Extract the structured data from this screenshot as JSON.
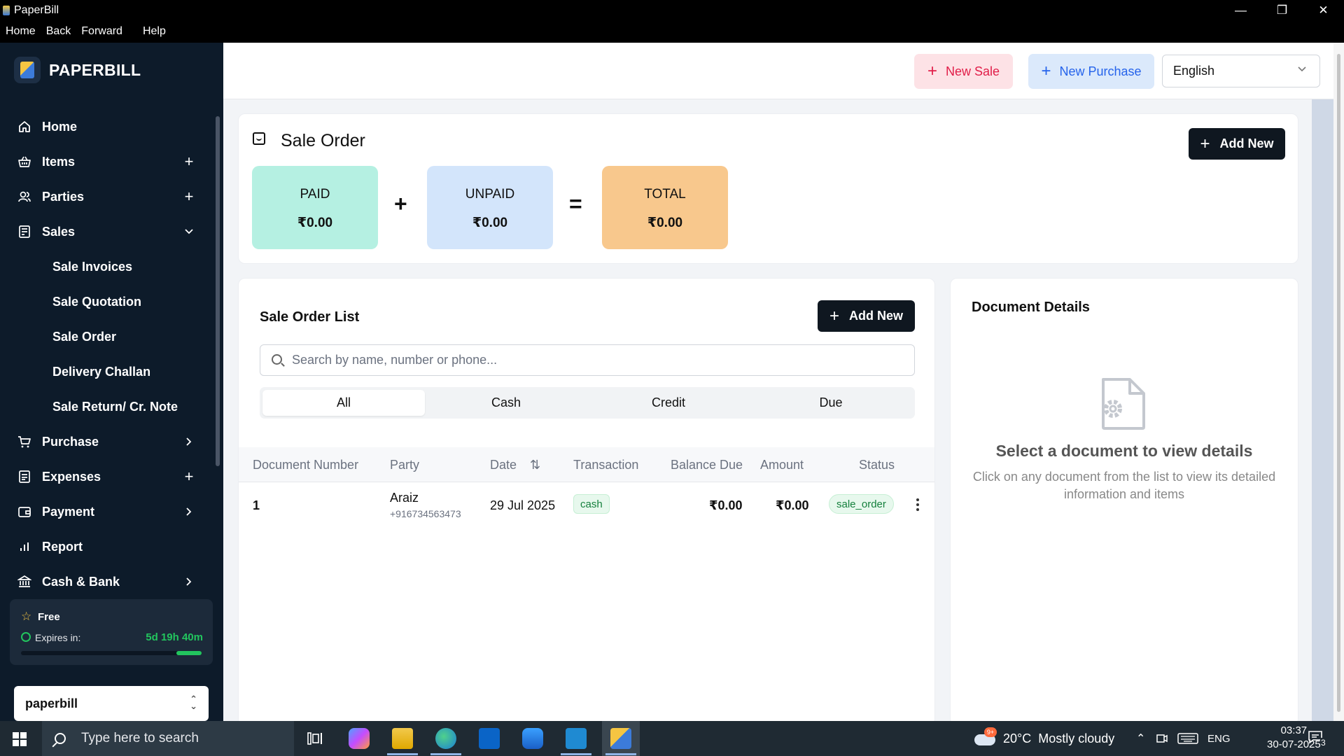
{
  "window": {
    "title": "PaperBill",
    "controls": [
      "—",
      "❐",
      "✕"
    ]
  },
  "menu": {
    "home": "Home",
    "back": "Back",
    "forward": "Forward",
    "help": "Help"
  },
  "sidebar": {
    "brand": "PAPERBILL",
    "items": [
      {
        "label": "Home",
        "icon": "home-icon",
        "trail": ""
      },
      {
        "label": "Items",
        "icon": "basket-icon",
        "trail": "+"
      },
      {
        "label": "Parties",
        "icon": "users-icon",
        "trail": "+"
      },
      {
        "label": "Sales",
        "icon": "receipt-icon",
        "trail": "⌄"
      }
    ],
    "sales_sub": [
      "Sale Invoices",
      "Sale Quotation",
      "Sale Order",
      "Delivery Challan",
      "Sale Return/ Cr. Note"
    ],
    "items_after": [
      {
        "label": "Purchase",
        "icon": "cart-icon",
        "trail": "›"
      },
      {
        "label": "Expenses",
        "icon": "expenses-icon",
        "trail": "+"
      },
      {
        "label": "Payment",
        "icon": "wallet-icon",
        "trail": "›"
      },
      {
        "label": "Report",
        "icon": "bar-chart-icon",
        "trail": ""
      },
      {
        "label": "Cash & Bank",
        "icon": "bank-icon",
        "trail": "›"
      }
    ],
    "plan": {
      "name": "Free",
      "expires_label": "Expires in:",
      "remaining": "5d 19h 40m",
      "progress_fraction": 0.14
    },
    "workspace": "paperbill"
  },
  "header": {
    "new_sale": "New Sale",
    "new_purchase": "New Purchase",
    "language": "English"
  },
  "summary": {
    "title": "Sale Order",
    "add_new": "Add New",
    "paid_label": "PAID",
    "paid_value": "₹0.00",
    "unpaid_label": "UNPAID",
    "unpaid_value": "₹0.00",
    "total_label": "TOTAL",
    "total_value": "₹0.00",
    "plus": "+",
    "equals": "=",
    "colors": {
      "paid": "#b5f0e2",
      "unpaid": "#d3e5fb",
      "total": "#f8c88d"
    }
  },
  "list": {
    "title": "Sale Order List",
    "add_new": "Add New",
    "search_placeholder": "Search by name, number or phone...",
    "tabs": [
      "All",
      "Cash",
      "Credit",
      "Due"
    ],
    "active_tab": "All",
    "columns": [
      "Document Number",
      "Party",
      "Date",
      "Transaction",
      "Balance Due",
      "Amount",
      "Status"
    ],
    "sort_glyph": "⇅",
    "rows": [
      {
        "doc_number": "1",
        "party": "Araiz",
        "phone": "+916734563473",
        "date": "29 Jul 2025",
        "transaction": "cash",
        "balance_due": "₹0.00",
        "amount": "₹0.00",
        "status": "sale_order"
      }
    ]
  },
  "details": {
    "title": "Document Details",
    "empty_title": "Select a document to view details",
    "empty_text": "Click on any document from the list to view its detailed information and items"
  },
  "taskbar": {
    "search_placeholder": "Type here to search",
    "weather": "20°C  Mostly cloudy",
    "weather_badge": "9+",
    "language": "ENG",
    "time": "03:37",
    "date": "30-07-2025",
    "notifications": "3"
  }
}
